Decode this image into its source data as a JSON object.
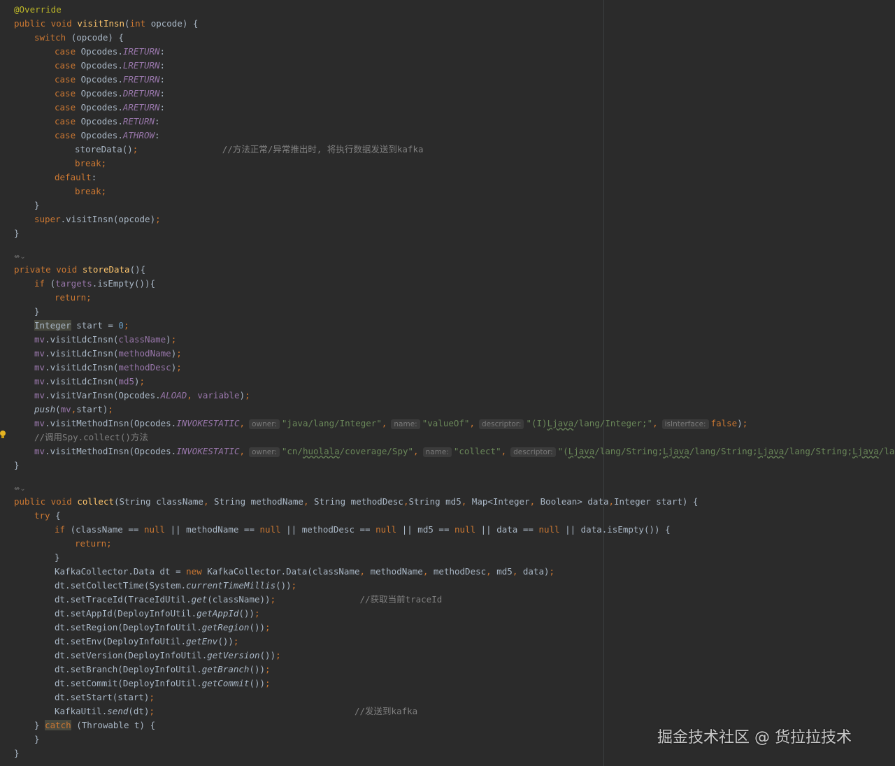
{
  "watermark": "掘金技术社区 @ 货拉拉技术",
  "code": {
    "l1_annotation": "@Override",
    "l2_method": "visitInsn",
    "l8_case_op": "case Opcodes.",
    "l9_comment": "//方法正常/异常推出时, 将执行数据发送到kafka",
    "l29_comment": "//调用Spy.collect()方法",
    "l37_comment": "//获取当前traceId",
    "l45_comment": "//发送到kafka",
    "hint_owner": "owner:",
    "hint_name": "name:",
    "hint_descriptor": "descriptor:",
    "hint_isInterface": "isInterface:",
    "gutter_icon": "⇎⌄"
  },
  "colors": {
    "background": "#2b2b2b",
    "keyword": "#cc7832",
    "string": "#6a8759",
    "method_decl": "#ffc66d",
    "field": "#9876aa",
    "comment": "#808080",
    "number": "#6897bb"
  }
}
